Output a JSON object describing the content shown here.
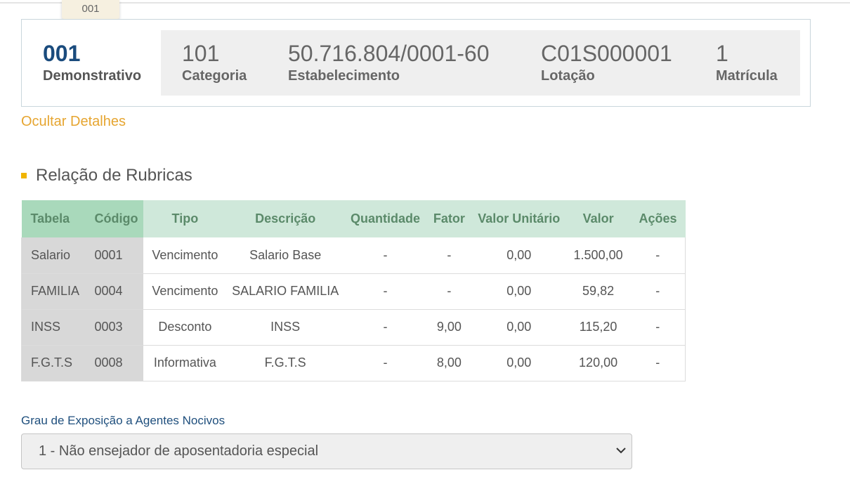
{
  "tooltip": {
    "text": "001"
  },
  "summary": {
    "demonstrativo": {
      "value": "001",
      "label": "Demonstrativo"
    },
    "categoria": {
      "value": "101",
      "label": "Categoria"
    },
    "estabelecimento": {
      "value": "50.716.804/0001-60",
      "label": "Estabelecimento"
    },
    "lotacao": {
      "value": "C01S000001",
      "label": "Lotação"
    },
    "matricula": {
      "value": "1",
      "label": "Matrícula"
    }
  },
  "toggle_link": "Ocultar Detalhes",
  "section_title": "Relação de Rubricas",
  "table": {
    "headers": [
      "Tabela",
      "Código",
      "Tipo",
      "Descrição",
      "Quantidade",
      "Fator",
      "Valor Unitário",
      "Valor",
      "Ações"
    ],
    "rows": [
      [
        "Salario",
        "0001",
        "Vencimento",
        "Salario Base",
        "-",
        "-",
        "0,00",
        "1.500,00",
        "-"
      ],
      [
        "FAMILIA",
        "0004",
        "Vencimento",
        "SALARIO FAMILIA",
        "-",
        "-",
        "0,00",
        "59,82",
        "-"
      ],
      [
        "INSS",
        "0003",
        "Desconto",
        "INSS",
        "-",
        "9,00",
        "0,00",
        "115,20",
        "-"
      ],
      [
        "F.G.T.S",
        "0008",
        "Informativa",
        "F.G.T.S",
        "-",
        "8,00",
        "0,00",
        "120,00",
        "-"
      ]
    ]
  },
  "exposicao": {
    "label": "Grau de Exposição a Agentes Nocivos",
    "selected": "1 - Não ensejador de aposentadoria especial"
  },
  "colors": {
    "accent_orange": "#e6a530",
    "header_green": "#cfe8da",
    "header_green_dark": "#a9d9bb",
    "title_blue": "#1a4b7d"
  }
}
